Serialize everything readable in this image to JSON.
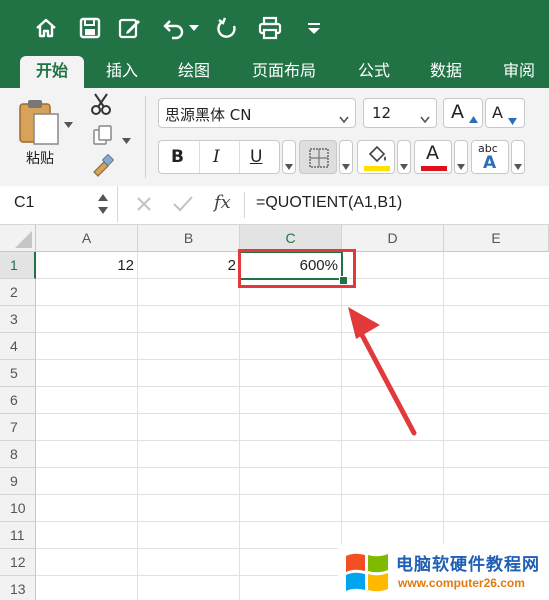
{
  "tabs": [
    "开始",
    "插入",
    "绘图",
    "页面布局",
    "公式",
    "数据",
    "审阅"
  ],
  "ribbon": {
    "paste_label": "粘贴",
    "font_name": "思源黑体 CN",
    "font_size": "12",
    "bold": "B",
    "italic": "I",
    "underline": "U",
    "grow_font": "A",
    "shrink_font": "A",
    "font_color_letter": "A",
    "text_effect_top": "abc",
    "text_effect_bottom": "A"
  },
  "formula": {
    "name_box": "C1",
    "fx": "fx",
    "content": "=QUOTIENT(A1,B1)"
  },
  "columns": [
    "A",
    "B",
    "C",
    "D",
    "E"
  ],
  "rows": [
    "1",
    "2",
    "3",
    "4",
    "5",
    "6",
    "7",
    "8",
    "9",
    "10",
    "11",
    "12",
    "13"
  ],
  "cells": {
    "A1": "12",
    "B1": "2",
    "C1": "600%"
  },
  "watermark": {
    "title": "电脑软硬件教程网",
    "url": "www.computer26.com"
  },
  "colors": {
    "excel_green": "#217346",
    "highlight_yellow": "#ffe100",
    "font_red": "#e0101a",
    "annotation_red": "#e23a3a"
  }
}
